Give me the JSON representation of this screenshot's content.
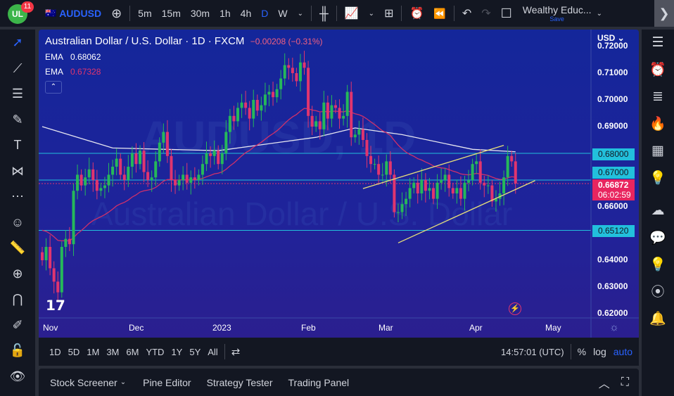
{
  "topbar": {
    "badge": "11",
    "logo": "UL",
    "symbol": "AUDUSD",
    "intervals": [
      "5m",
      "15m",
      "30m",
      "1h",
      "4h",
      "D",
      "W"
    ],
    "active_interval": "D",
    "layout_name": "Wealthy Educ...",
    "save": "Save"
  },
  "legend": {
    "title": "Australian Dollar / U.S. Dollar · 1D · FXCM",
    "change": "−0.00208 (−0.31%)",
    "ema1_label": "EMA",
    "ema1_value": "0.68062",
    "ema2_label": "EMA",
    "ema2_value": "0.67328"
  },
  "watermark": {
    "symbol": "AUDUSD, 1D",
    "name": "Australian Dollar / U.S. Dollar"
  },
  "price_axis": {
    "currency": "USD",
    "ticks": [
      "0.72000",
      "0.71000",
      "0.70000",
      "0.69000",
      "0.66000",
      "0.64000",
      "0.63000",
      "0.62000"
    ],
    "tags": [
      {
        "label": "0.68000",
        "price": 0.68
      },
      {
        "label": "0.67000",
        "price": 0.67
      },
      {
        "label": "0.65120",
        "price": 0.6512
      }
    ],
    "last_price": "0.66872",
    "countdown": "06:02:59"
  },
  "time_axis": [
    "Nov",
    "Dec",
    "2023",
    "Feb",
    "Mar",
    "Apr",
    "May"
  ],
  "bottom_toolbar": {
    "ranges": [
      "1D",
      "5D",
      "1M",
      "3M",
      "6M",
      "YTD",
      "1Y",
      "5Y",
      "All"
    ],
    "clock": "14:57:01 (UTC)",
    "percent": "%",
    "log": "log",
    "auto": "auto"
  },
  "panel": {
    "tabs": [
      "Stock Screener",
      "Pine Editor",
      "Strategy Tester",
      "Trading Panel"
    ]
  },
  "colors": {
    "up": "#26b85a",
    "down": "#e0356e",
    "ema_slow": "#e6e6f0",
    "ema_fast": "#d0306a",
    "hline": "#22c0dc",
    "channel": "#e8e07a"
  },
  "chart_data": {
    "type": "candlestick",
    "closes": [
      0.64,
      0.645,
      0.637,
      0.632,
      0.628,
      0.645,
      0.648,
      0.646,
      0.666,
      0.672,
      0.668,
      0.671,
      0.674,
      0.67,
      0.666,
      0.667,
      0.668,
      0.672,
      0.675,
      0.678,
      0.672,
      0.67,
      0.675,
      0.68,
      0.676,
      0.681,
      0.673,
      0.67,
      0.671,
      0.677,
      0.684,
      0.688,
      0.679,
      0.67,
      0.668,
      0.67,
      0.672,
      0.669,
      0.671,
      0.67,
      0.672,
      0.676,
      0.68,
      0.679,
      0.681,
      0.676,
      0.68,
      0.688,
      0.694,
      0.692,
      0.697,
      0.699,
      0.697,
      0.693,
      0.7,
      0.696,
      0.698,
      0.702,
      0.703,
      0.701,
      0.704,
      0.708,
      0.713,
      0.712,
      0.71,
      0.707,
      0.714,
      0.712,
      0.694,
      0.69,
      0.692,
      0.689,
      0.699,
      0.693,
      0.698,
      0.697,
      0.693,
      0.694,
      0.703,
      0.686,
      0.687,
      0.689,
      0.685,
      0.679,
      0.676,
      0.676,
      0.672,
      0.672,
      0.677,
      0.672,
      0.658,
      0.658,
      0.661,
      0.663,
      0.667,
      0.669,
      0.665,
      0.67,
      0.666,
      0.667,
      0.663,
      0.669,
      0.67,
      0.672,
      0.667,
      0.665,
      0.667,
      0.663,
      0.669,
      0.67,
      0.676,
      0.677,
      0.669,
      0.668,
      0.668,
      0.662,
      0.663,
      0.665,
      0.671,
      0.679,
      0.677,
      0.6687
    ],
    "ema_slow_points": [
      [
        0,
        0.69
      ],
      [
        18,
        0.682
      ],
      [
        45,
        0.681
      ],
      [
        70,
        0.686
      ],
      [
        80,
        0.6895
      ],
      [
        92,
        0.687
      ],
      [
        110,
        0.6815
      ],
      [
        121,
        0.6806
      ]
    ],
    "ema_fast_seed": 0.652,
    "hlines": [
      0.68,
      0.67,
      0.6512
    ],
    "last_price": 0.6687,
    "channel": [
      [
        [
          82,
          0.6668
        ],
        [
          118,
          0.683
        ]
      ],
      [
        [
          91,
          0.6465
        ],
        [
          126,
          0.6698
        ]
      ]
    ],
    "ylim": [
      0.618,
      0.7228
    ]
  }
}
